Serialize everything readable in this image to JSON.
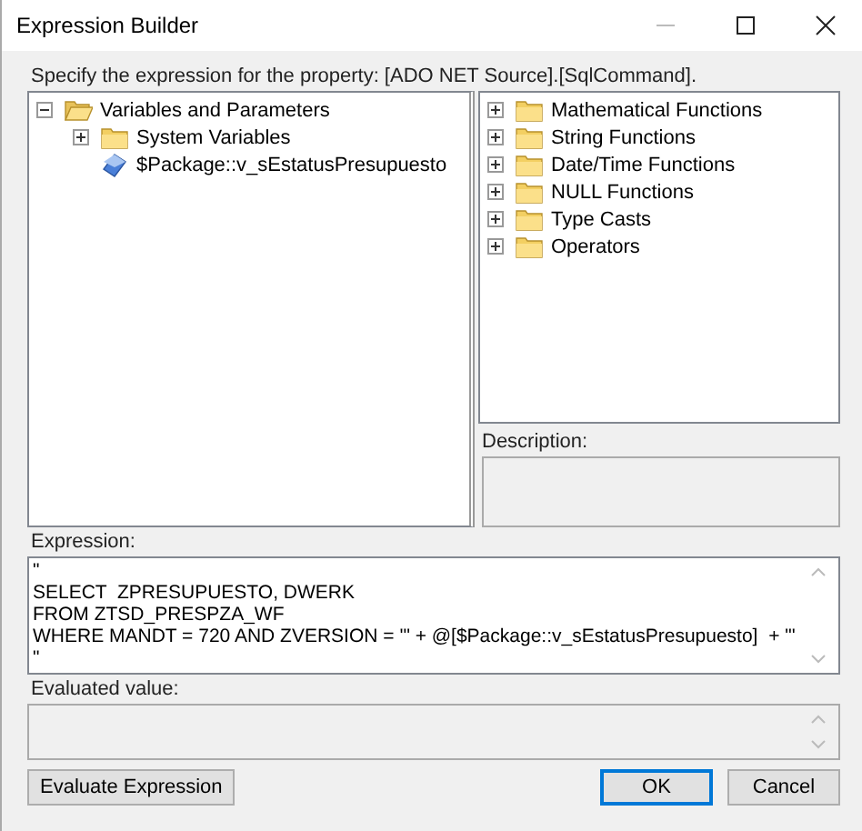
{
  "window": {
    "title": "Expression Builder"
  },
  "prompt": "Specify the expression for the property: [ADO NET Source].[SqlCommand].",
  "variables_tree": [
    {
      "label": "Variables and Parameters",
      "kind": "folder",
      "expanded": true,
      "children": [
        {
          "label": "System Variables",
          "kind": "folder",
          "expanded": false
        },
        {
          "label": "$Package::v_sEstatusPresupuesto",
          "kind": "variable"
        }
      ]
    }
  ],
  "functions_tree": [
    {
      "label": "Mathematical Functions",
      "kind": "folder",
      "expanded": false
    },
    {
      "label": "String Functions",
      "kind": "folder",
      "expanded": false
    },
    {
      "label": "Date/Time Functions",
      "kind": "folder",
      "expanded": false
    },
    {
      "label": "NULL Functions",
      "kind": "folder",
      "expanded": false
    },
    {
      "label": "Type Casts",
      "kind": "folder",
      "expanded": false
    },
    {
      "label": "Operators",
      "kind": "folder",
      "expanded": false
    }
  ],
  "description": {
    "label": "Description:"
  },
  "expression": {
    "label": "Expression:",
    "value": "\"\nSELECT  ZPRESUPUESTO, DWERK\nFROM ZTSD_PRESPZA_WF\nWHERE MANDT = 720 AND ZVERSION = '\" + @[$Package::v_sEstatusPresupuesto]  + \"'\n\""
  },
  "evaluated": {
    "label": "Evaluated value:"
  },
  "buttons": [
    {
      "label": "Evaluate Expression",
      "kind": "left"
    },
    {
      "label": "OK",
      "kind": "default"
    },
    {
      "label": "Cancel",
      "kind": "normal"
    }
  ]
}
